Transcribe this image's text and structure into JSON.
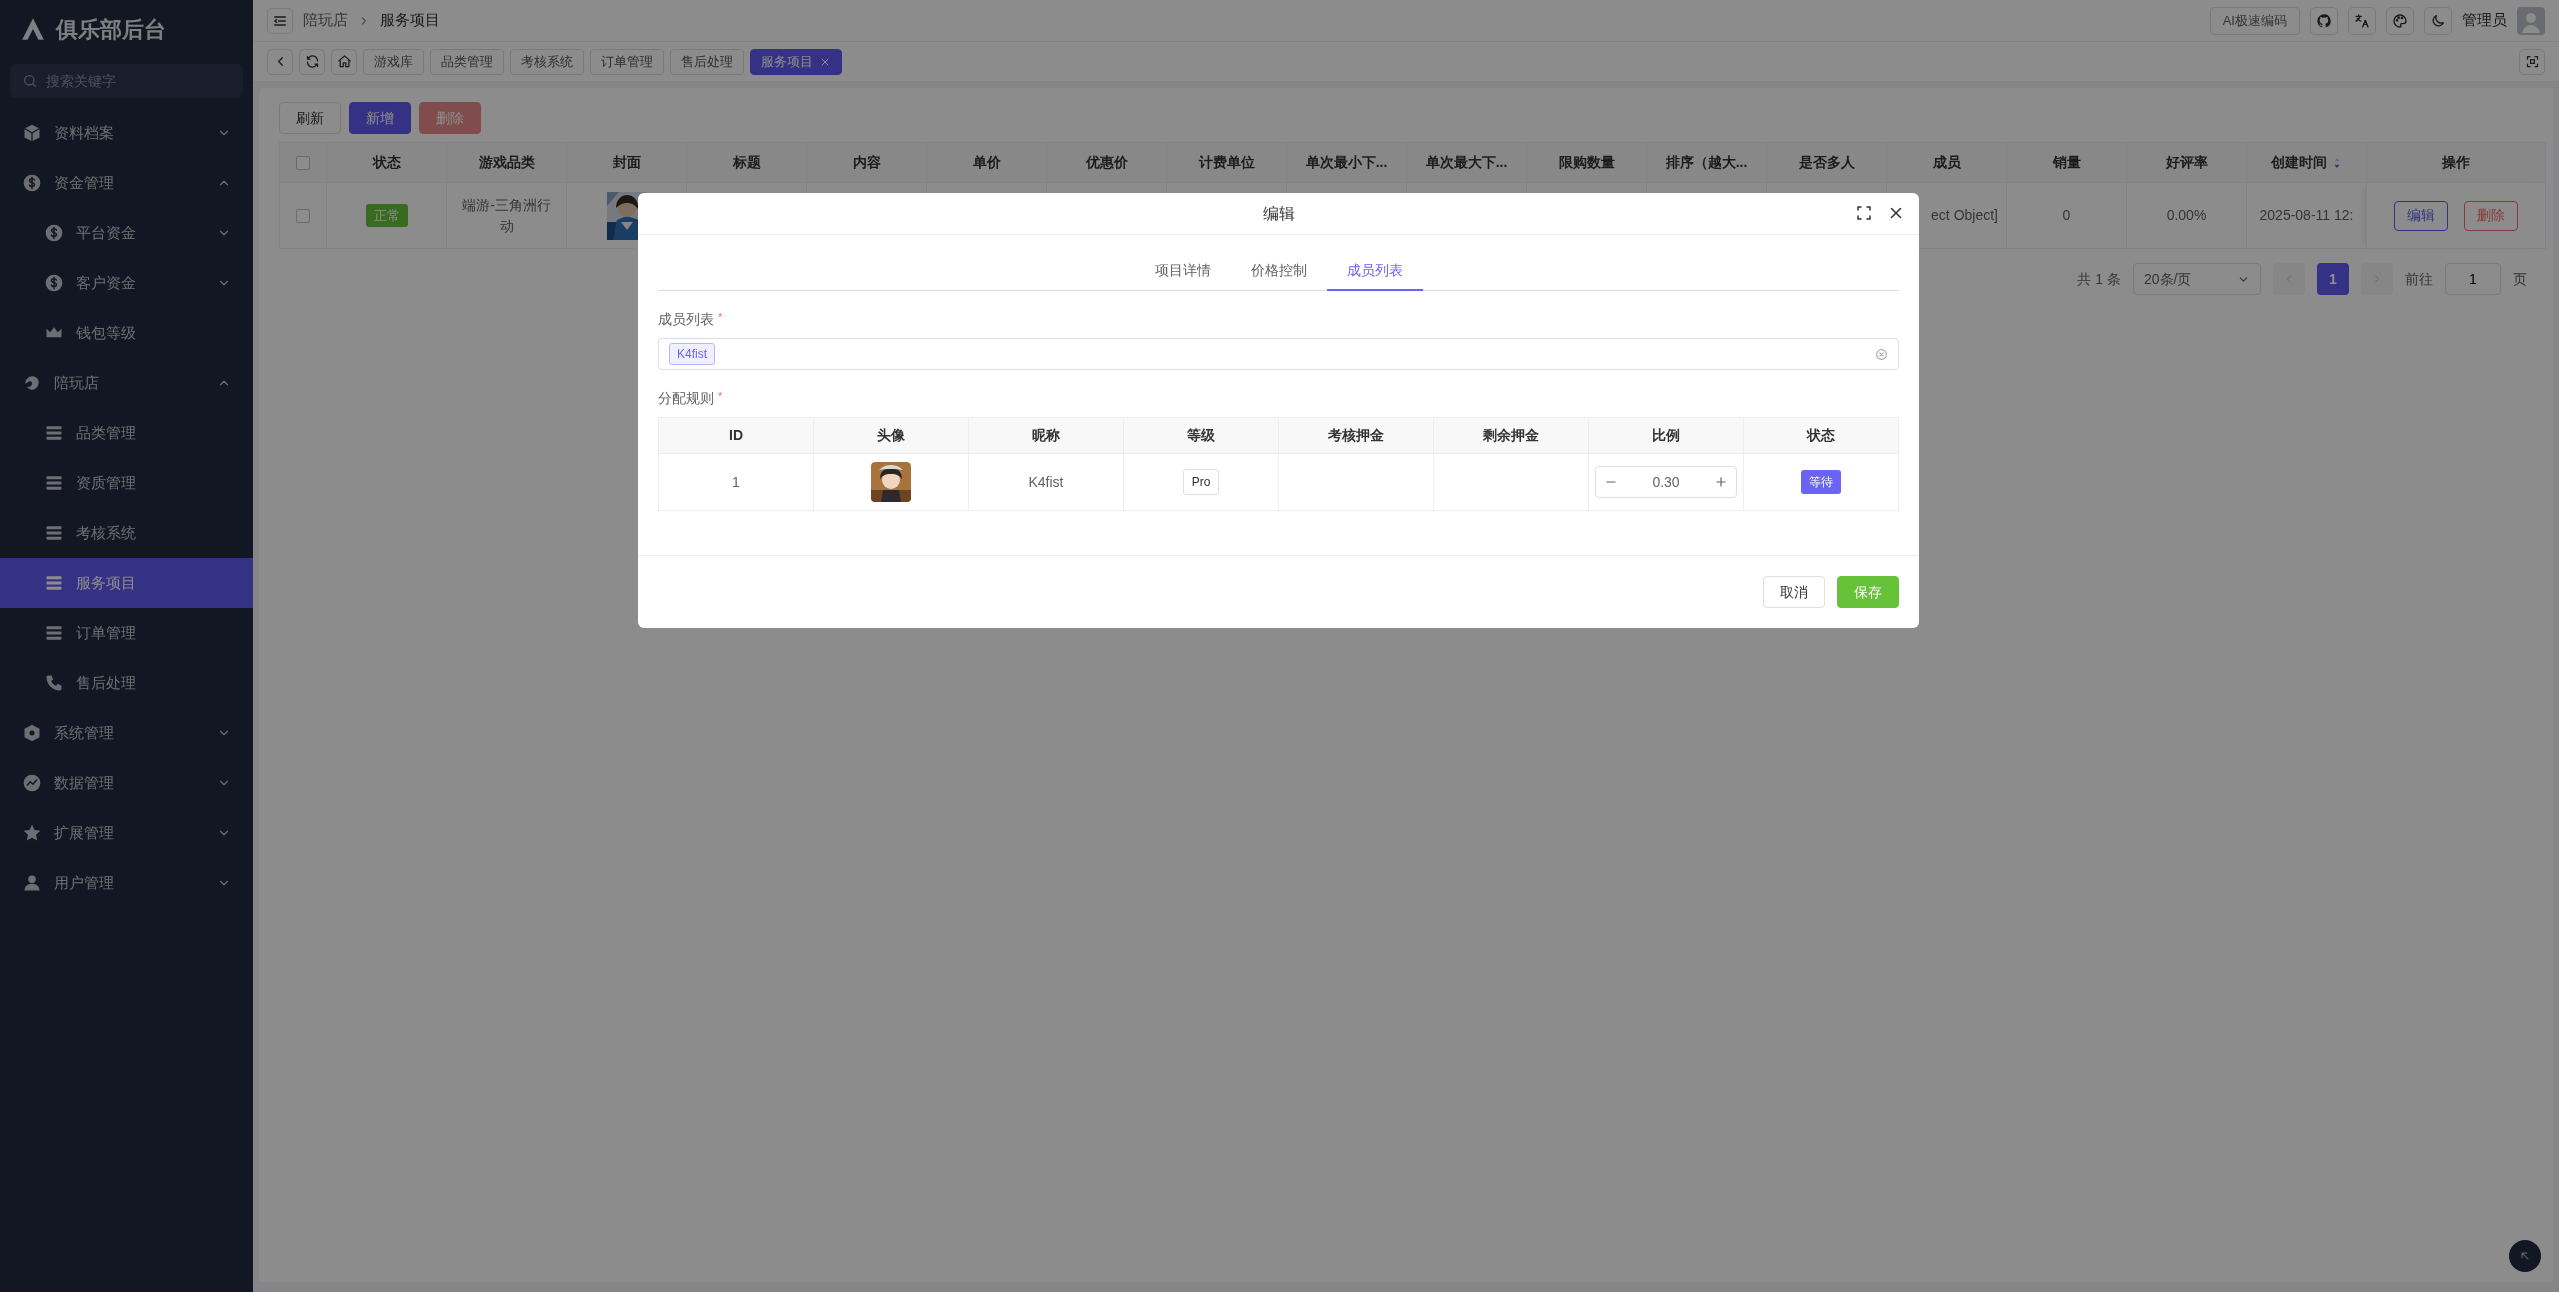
{
  "sidebar": {
    "title": "俱乐部后台",
    "search": {
      "placeholder": "搜索关键字"
    },
    "items": [
      {
        "label": "资料档案",
        "expanded": false,
        "selected": false
      },
      {
        "label": "资金管理",
        "expanded": true,
        "selected": false,
        "children": [
          {
            "label": "平台资金",
            "expanded": false,
            "selected": false
          },
          {
            "label": "客户资金",
            "expanded": false,
            "selected": false
          },
          {
            "label": "钱包等级",
            "selected": false
          }
        ]
      },
      {
        "label": "陪玩店",
        "expanded": true,
        "selected": false,
        "children": [
          {
            "label": "品类管理",
            "selected": false
          },
          {
            "label": "资质管理",
            "selected": false
          },
          {
            "label": "考核系统",
            "selected": false
          },
          {
            "label": "服务项目",
            "selected": true
          },
          {
            "label": "订单管理",
            "selected": false
          },
          {
            "label": "售后处理",
            "selected": false
          }
        ]
      },
      {
        "label": "系统管理",
        "expanded": false,
        "selected": false
      },
      {
        "label": "数据管理",
        "expanded": false,
        "selected": false
      },
      {
        "label": "扩展管理",
        "expanded": false,
        "selected": false
      },
      {
        "label": "用户管理",
        "expanded": false,
        "selected": false
      }
    ]
  },
  "header": {
    "breadcrumb": [
      "陪玩店",
      "服务项目"
    ],
    "ai_button": "AI极速编码",
    "user_name": "管理员"
  },
  "page_tabs": [
    {
      "label": "游戏库",
      "selected": false
    },
    {
      "label": "品类管理",
      "selected": false
    },
    {
      "label": "考核系统",
      "selected": false
    },
    {
      "label": "订单管理",
      "selected": false
    },
    {
      "label": "售后处理",
      "selected": false
    },
    {
      "label": "服务项目",
      "selected": true
    }
  ],
  "toolbar": [
    {
      "label": "刷新",
      "kind": "default",
      "disabled": false
    },
    {
      "label": "新增",
      "kind": "primary",
      "disabled": false
    },
    {
      "label": "删除",
      "kind": "danger",
      "disabled": true
    }
  ],
  "table": {
    "columns": [
      {
        "label": "状态"
      },
      {
        "label": "游戏品类"
      },
      {
        "label": "封面"
      },
      {
        "label": "标题"
      },
      {
        "label": "内容"
      },
      {
        "label": "单价"
      },
      {
        "label": "优惠价"
      },
      {
        "label": "计费单位"
      },
      {
        "label": "单次最小下..."
      },
      {
        "label": "单次最大下..."
      },
      {
        "label": "限购数量"
      },
      {
        "label": "排序（越大..."
      },
      {
        "label": "是否多人"
      },
      {
        "label": "成员"
      },
      {
        "label": "销量"
      },
      {
        "label": "好评率"
      },
      {
        "label": "创建时间",
        "sort_descending": true
      },
      {
        "label": "操作"
      }
    ],
    "header_checked": false,
    "rows": [
      {
        "checked": false,
        "status": "正常",
        "game_category": "端游-三角洲行动",
        "cover": {
          "kind": "picture"
        },
        "member": "ect Object]",
        "sales": "0",
        "rating": "0.00%",
        "created": "2025-08-11 12:",
        "actions": [
          {
            "label": "编辑",
            "kind": "primary"
          },
          {
            "label": "删除",
            "kind": "danger"
          }
        ]
      }
    ]
  },
  "pagination": {
    "total": "共 1 条",
    "page_size": "20条/页",
    "pages": [
      {
        "label": "1",
        "selected": true
      }
    ],
    "goto_label": "前往",
    "goto_value": "1",
    "page_suffix": "页"
  },
  "modal": {
    "title": "编辑",
    "tabs": [
      {
        "label": "项目详情",
        "selected": false
      },
      {
        "label": "价格控制",
        "selected": false
      },
      {
        "label": "成员列表",
        "selected": true
      }
    ],
    "members_field": {
      "label": "成员列表",
      "required_mark": "*",
      "tags": [
        "K4fist"
      ]
    },
    "rules": {
      "label": "分配规则",
      "required_mark": "*",
      "columns": [
        "ID",
        "头像",
        "昵称",
        "等级",
        "考核押金",
        "剩余押金",
        "比例",
        "状态"
      ],
      "rows": [
        {
          "id": "1",
          "avatar": {
            "kind": "picture"
          },
          "nickname": "K4fist",
          "level": "Pro",
          "ratio": "0.30",
          "status": "等待"
        }
      ]
    },
    "buttons": [
      {
        "label": "取消",
        "kind": "default"
      },
      {
        "label": "保存",
        "kind": "success"
      }
    ]
  }
}
